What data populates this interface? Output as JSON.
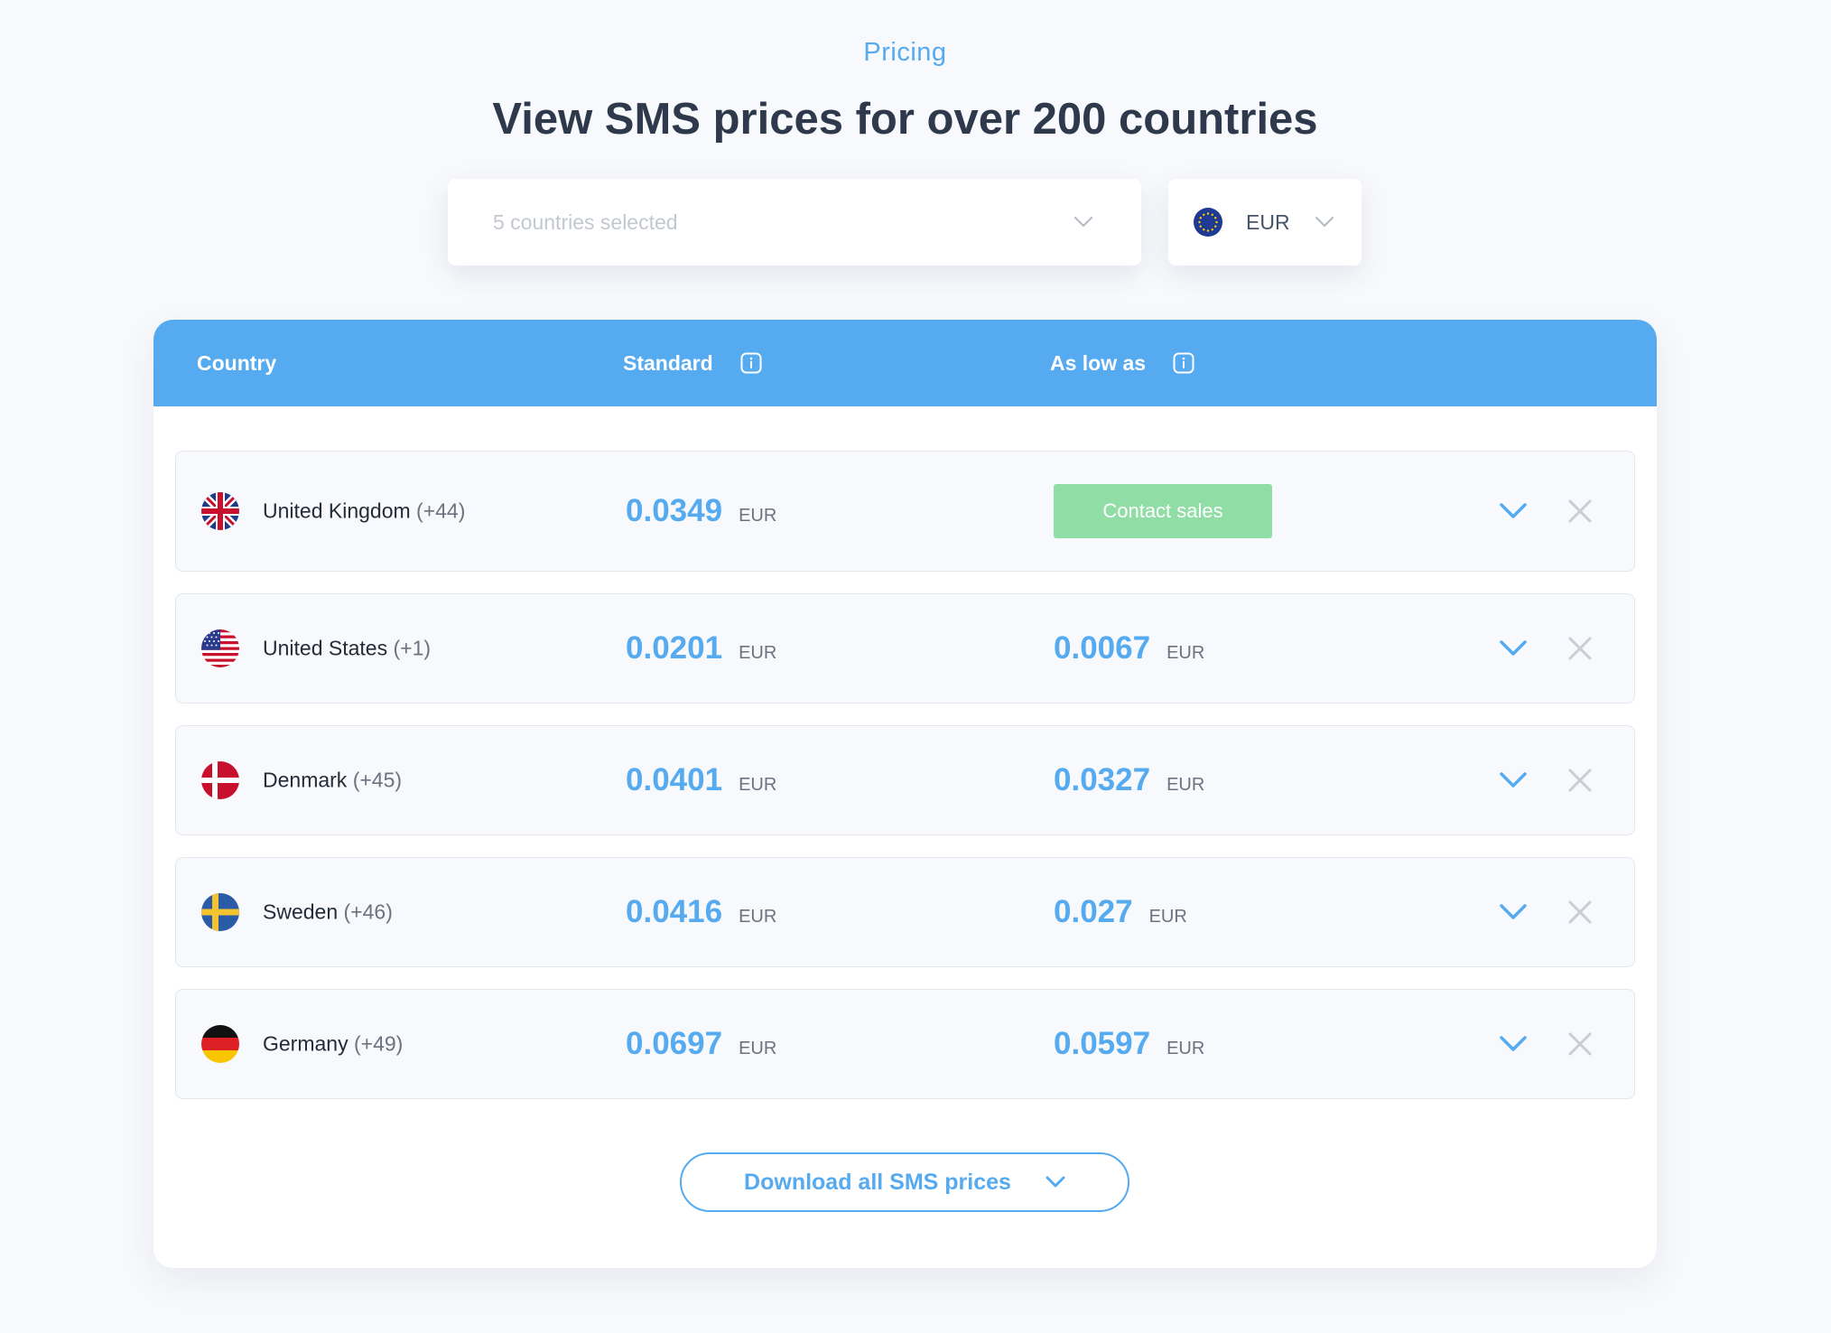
{
  "header": {
    "eyebrow": "Pricing",
    "title": "View SMS prices for over 200 countries"
  },
  "filters": {
    "countries_placeholder": "5 countries selected",
    "currency": "EUR",
    "currency_icon": "eu-flag-icon"
  },
  "table": {
    "columns": {
      "country": "Country",
      "standard": "Standard",
      "as_low_as": "As low as"
    },
    "rows": [
      {
        "country": "United Kingdom",
        "code": "(+44)",
        "flag": "uk-flag-icon",
        "standard": "0.0349",
        "standard_unit": "EUR",
        "as_low_as": null,
        "as_low_as_unit": null,
        "action_label": "Contact sales"
      },
      {
        "country": "United States",
        "code": "(+1)",
        "flag": "us-flag-icon",
        "standard": "0.0201",
        "standard_unit": "EUR",
        "as_low_as": "0.0067",
        "as_low_as_unit": "EUR"
      },
      {
        "country": "Denmark",
        "code": "(+45)",
        "flag": "dk-flag-icon",
        "standard": "0.0401",
        "standard_unit": "EUR",
        "as_low_as": "0.0327",
        "as_low_as_unit": "EUR"
      },
      {
        "country": "Sweden",
        "code": "(+46)",
        "flag": "se-flag-icon",
        "standard": "0.0416",
        "standard_unit": "EUR",
        "as_low_as": "0.027",
        "as_low_as_unit": "EUR"
      },
      {
        "country": "Germany",
        "code": "(+49)",
        "flag": "de-flag-icon",
        "standard": "0.0697",
        "standard_unit": "EUR",
        "as_low_as": "0.0597",
        "as_low_as_unit": "EUR"
      }
    ]
  },
  "download": {
    "label": "Download all SMS prices"
  },
  "colors": {
    "accent": "#55aaf0",
    "contact_sales": "#90dea6",
    "heading": "#2e3a4b"
  }
}
